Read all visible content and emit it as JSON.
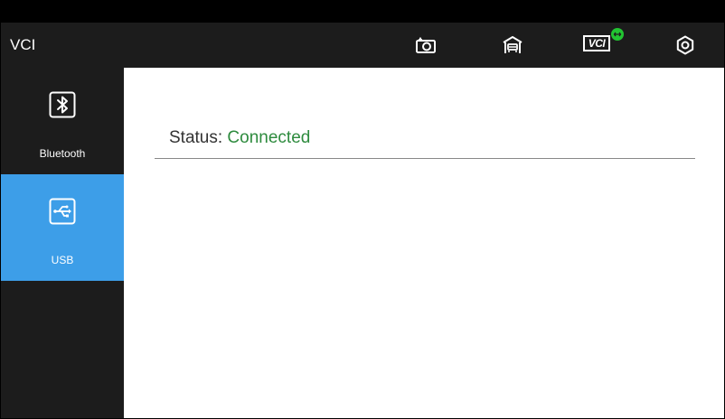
{
  "app": {
    "title": "VCI"
  },
  "toolbar": {
    "icons": [
      "camera-icon",
      "garage-icon",
      "vci-connection-icon",
      "settings-icon"
    ],
    "vci_label": "VCI",
    "vci_status_color": "#22c432"
  },
  "sidebar": {
    "items": [
      {
        "label": "Bluetooth",
        "icon": "bluetooth-icon",
        "active": false
      },
      {
        "label": "USB",
        "icon": "usb-icon",
        "active": true
      }
    ],
    "active_color": "#3d9ee8"
  },
  "main": {
    "status_label": "Status: ",
    "status_value": "Connected",
    "status_color": "#2e8b3e"
  }
}
